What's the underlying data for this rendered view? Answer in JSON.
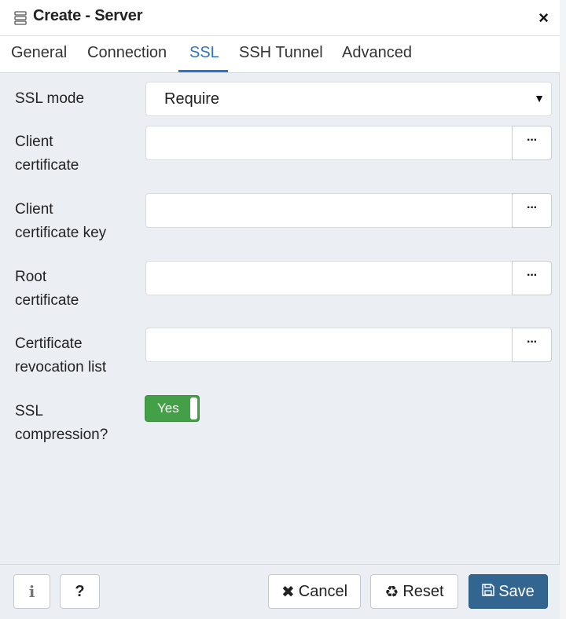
{
  "dialog": {
    "title": "Create - Server",
    "close_label": "×"
  },
  "tabs": [
    {
      "label": "General",
      "active": false
    },
    {
      "label": "Connection",
      "active": false
    },
    {
      "label": "SSL",
      "active": true
    },
    {
      "label": "SSH Tunnel",
      "active": false
    },
    {
      "label": "Advanced",
      "active": false
    }
  ],
  "form": {
    "ssl_mode": {
      "label": "SSL mode",
      "value": "Require"
    },
    "client_certificate": {
      "label_line1": "Client",
      "label_line2": "certificate",
      "value": "",
      "browse_label": "···"
    },
    "client_certificate_key": {
      "label_line1": "Client",
      "label_line2": "certificate key",
      "value": "",
      "browse_label": "···"
    },
    "root_certificate": {
      "label_line1": "Root",
      "label_line2": "certificate",
      "value": "",
      "browse_label": "···"
    },
    "crl": {
      "label_line1": "Certificate",
      "label_line2": "revocation list",
      "value": "",
      "browse_label": "···"
    },
    "ssl_compression": {
      "label_line1": "SSL",
      "label_line2": "compression?",
      "toggle_label": "Yes",
      "on": true
    }
  },
  "footer": {
    "info_label": "i",
    "help_label": "?",
    "cancel_label": "Cancel",
    "reset_label": "Reset",
    "save_label": "Save"
  },
  "colors": {
    "accent": "#2c76c7",
    "toggle_on": "#43a047",
    "save_button": "#326690",
    "panel_bg": "#ebeef3"
  }
}
